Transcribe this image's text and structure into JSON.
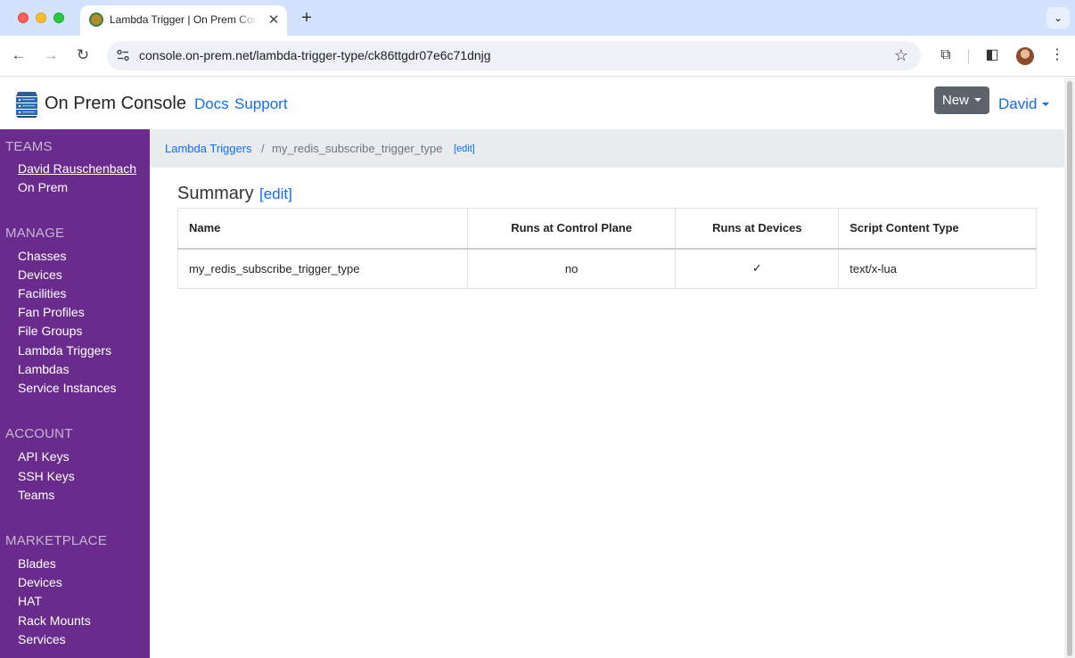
{
  "browser": {
    "tab_title": "Lambda Trigger | On Prem Console",
    "url": "console.on-prem.net/lambda-trigger-type/ck86ttgdr07e6c71dnjg"
  },
  "navbar": {
    "brand": "On Prem Console",
    "links": {
      "docs": "Docs",
      "support": "Support"
    },
    "new_button": "New",
    "user": "David"
  },
  "sidebar": {
    "teams": {
      "heading": "TEAMS",
      "items": [
        "David Rauschenbach",
        "On Prem"
      ]
    },
    "manage": {
      "heading": "MANAGE",
      "items": [
        "Chasses",
        "Devices",
        "Facilities",
        "Fan Profiles",
        "File Groups",
        "Lambda Triggers",
        "Lambdas",
        "Service Instances"
      ]
    },
    "account": {
      "heading": "ACCOUNT",
      "items": [
        "API Keys",
        "SSH Keys",
        "Teams"
      ]
    },
    "marketplace": {
      "heading": "MARKETPLACE",
      "items": [
        "Blades",
        "Devices",
        "HAT",
        "Rack Mounts",
        "Services"
      ]
    }
  },
  "breadcrumb": {
    "parent": "Lambda Triggers",
    "separator": "/",
    "current": "my_redis_subscribe_trigger_type",
    "edit": "[edit]"
  },
  "summary": {
    "title": "Summary",
    "edit": "[edit]",
    "columns": [
      "Name",
      "Runs at Control Plane",
      "Runs at Devices",
      "Script Content Type"
    ],
    "rows": [
      [
        "my_redis_subscribe_trigger_type",
        "no",
        "✓",
        "text/x-lua"
      ]
    ]
  },
  "colors": {
    "sidebar_bg": "#6a2c8c",
    "link": "#0d6efd",
    "breadcrumb_bg": "#e9ecef",
    "new_button_bg": "#5c636a"
  }
}
